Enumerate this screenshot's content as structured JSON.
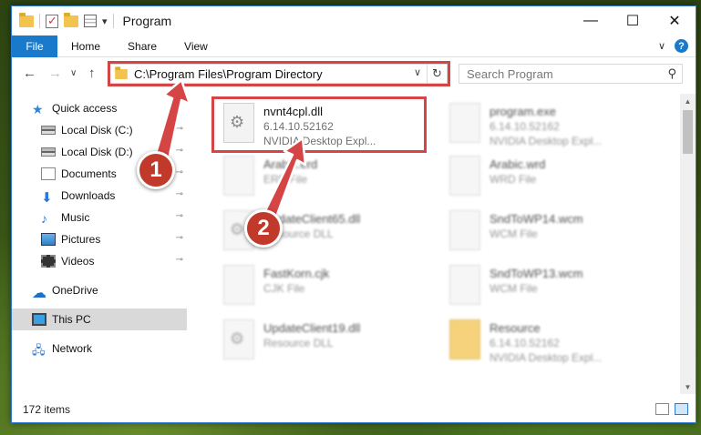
{
  "window": {
    "title": "Program",
    "min_glyph": "—",
    "max_glyph": "☐",
    "close_glyph": "✕"
  },
  "ribbon": {
    "file": "File",
    "tabs": [
      "Home",
      "Share",
      "View"
    ],
    "chevron": "∨",
    "help": "?"
  },
  "nav": {
    "back": "←",
    "forward": "→",
    "recent": "∨",
    "up": "↑",
    "address": "C:\\Program Files\\Program Directory",
    "address_dropdown": "∨",
    "refresh": "↻",
    "search_placeholder": "Search Program",
    "search_glyph": "⚲"
  },
  "sidebar": {
    "items": [
      {
        "label": "Quick access",
        "icon": "star-icon",
        "pinned": false
      },
      {
        "label": "Local Disk (C:)",
        "icon": "drive-icon",
        "pinned": true
      },
      {
        "label": "Local Disk (D:)",
        "icon": "drive-icon",
        "pinned": true
      },
      {
        "label": "Documents",
        "icon": "documents-icon",
        "pinned": true
      },
      {
        "label": "Downloads",
        "icon": "download-icon",
        "pinned": true
      },
      {
        "label": "Music",
        "icon": "music-icon",
        "pinned": true
      },
      {
        "label": "Pictures",
        "icon": "pictures-icon",
        "pinned": true
      },
      {
        "label": "Videos",
        "icon": "videos-icon",
        "pinned": true
      },
      {
        "label": "OneDrive",
        "icon": "cloud-icon",
        "pinned": false
      },
      {
        "label": "This PC",
        "icon": "computer-icon",
        "pinned": false
      },
      {
        "label": "Network",
        "icon": "network-icon",
        "pinned": false
      }
    ],
    "pin_glyph": "📌"
  },
  "files": [
    {
      "name": "nvnt4cpl.dll",
      "line2": "6.14.10.52162",
      "line3": "NVIDIA Desktop Expl...",
      "icon": "dll-icon"
    },
    {
      "name": "program.exe",
      "line2": "6.14.10.52162",
      "line3": "NVIDIA Desktop Expl...",
      "icon": "exe-icon"
    },
    {
      "name": "Arabic.erd",
      "line2": "ERD File",
      "line3": "",
      "icon": "file-icon"
    },
    {
      "name": "Arabic.wrd",
      "line2": "WRD File",
      "line3": "",
      "icon": "file-icon"
    },
    {
      "name": "UpdateClient65.dll",
      "line2": "Resource DLL",
      "line3": "",
      "icon": "dll-icon"
    },
    {
      "name": "SndToWP14.wcm",
      "line2": "WCM File",
      "line3": "",
      "icon": "file-icon"
    },
    {
      "name": "FastKorn.cjk",
      "line2": "CJK File",
      "line3": "",
      "icon": "file-icon"
    },
    {
      "name": "SndToWP13.wcm",
      "line2": "WCM File",
      "line3": "",
      "icon": "file-icon"
    },
    {
      "name": "UpdateClient19.dll",
      "line2": "Resource DLL",
      "line3": "",
      "icon": "dll-icon"
    },
    {
      "name": "Resource",
      "line2": "6.14.10.52162",
      "line3": "NVIDIA Desktop Expl...",
      "icon": "folder-icon"
    }
  ],
  "status": {
    "count": "172 items"
  },
  "annotations": {
    "step1": "1",
    "step2": "2",
    "color": "#d64545"
  }
}
